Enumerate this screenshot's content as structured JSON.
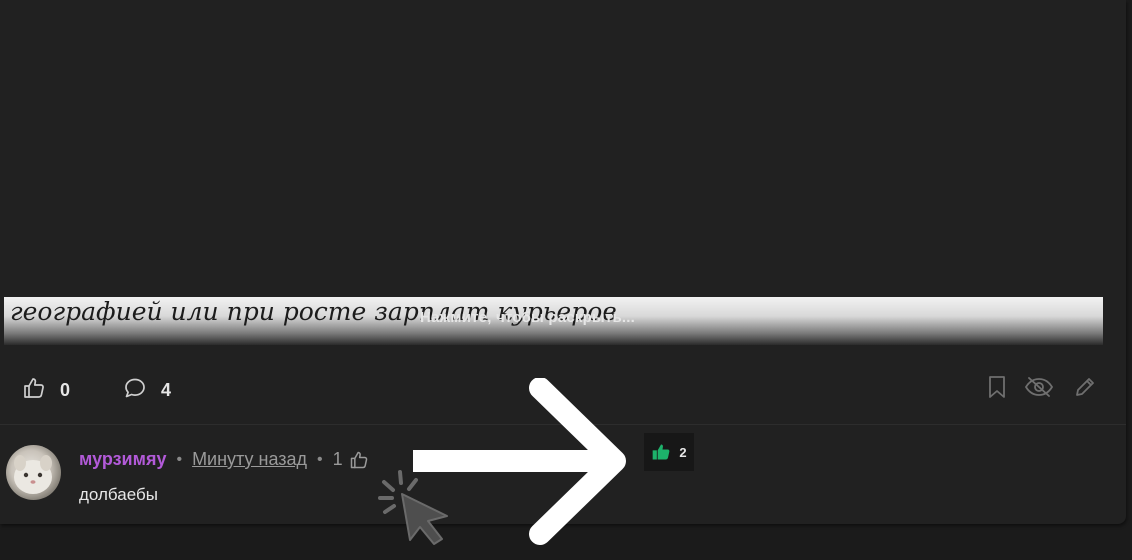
{
  "preview": {
    "text": "географией или при росте зарплат курьеров",
    "expand_label": "Нажмите, чтобы раскрыть..."
  },
  "actions": {
    "likes": "0",
    "comments": "4",
    "icons": [
      "thumb-up-icon",
      "comment-icon",
      "bookmark-icon",
      "eye-off-icon",
      "pencil-icon"
    ]
  },
  "comment": {
    "author": "мурзимяу",
    "time": "Минуту назад",
    "likes": "1",
    "text": "долбаебы"
  },
  "annotation": {
    "liked_count": "2",
    "liked_color": "#1db26b"
  },
  "colors": {
    "background": "#1b1b1b",
    "card": "#212121",
    "author": "#b25ad8",
    "text": "#e6e6e6",
    "muted": "#9a9a9a"
  }
}
